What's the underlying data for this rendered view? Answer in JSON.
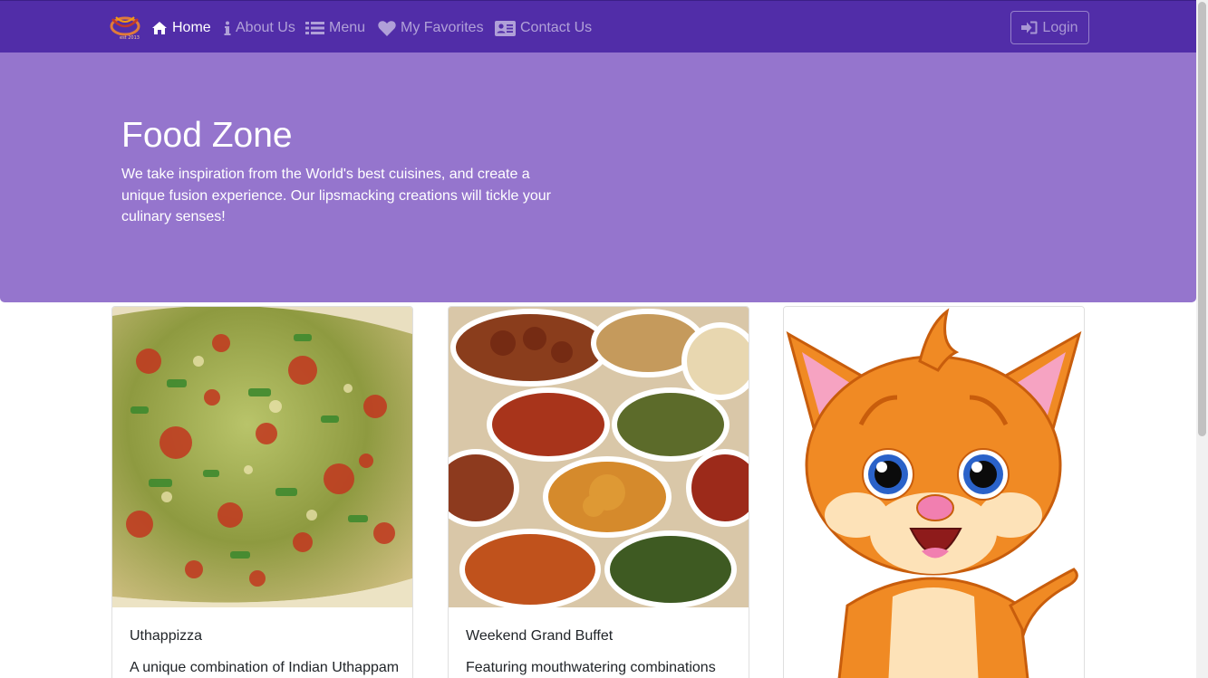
{
  "navbar": {
    "brand": "logo",
    "items": [
      {
        "label": "Home",
        "icon": "home-icon",
        "active": true
      },
      {
        "label": "About Us",
        "icon": "info-icon",
        "active": false
      },
      {
        "label": "Menu",
        "icon": "list-icon",
        "active": false
      },
      {
        "label": "My Favorites",
        "icon": "heart-icon",
        "active": false
      },
      {
        "label": "Contact Us",
        "icon": "address-card-icon",
        "active": false
      }
    ],
    "login_label": "Login",
    "login_icon": "sign-in-icon"
  },
  "jumbotron": {
    "title": "Food Zone",
    "text": "We take inspiration from the World's best cuisines, and create a unique fusion experience. Our lipsmacking creations will tickle your culinary senses!"
  },
  "cards": [
    {
      "title": "Uthappizza",
      "text": "A unique combination of Indian Uthappam",
      "image": "pizza-image"
    },
    {
      "title": "Weekend Grand Buffet",
      "text": "Featuring mouthwatering combinations",
      "image": "buffet-image"
    },
    {
      "title": "",
      "text": "",
      "image": "cartoon-cat-image"
    }
  ],
  "colors": {
    "navbar": "#512da8",
    "jumbotron": "#9575cd"
  }
}
